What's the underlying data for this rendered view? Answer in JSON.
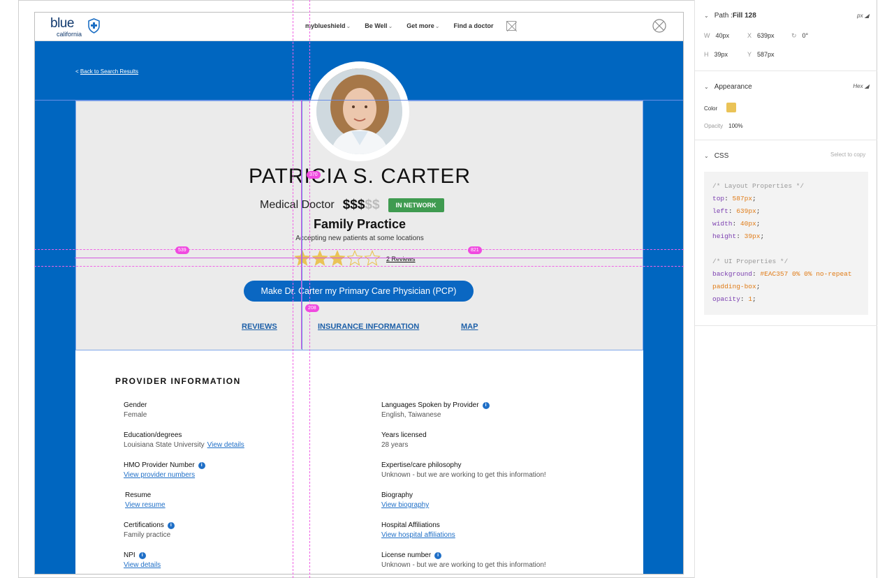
{
  "site": {
    "logo_word": "blue",
    "logo_sub": "california",
    "nav": [
      {
        "label": "myblueshield",
        "has_chevron": true
      },
      {
        "label": "Be Well",
        "has_chevron": true
      },
      {
        "label": "Get more",
        "has_chevron": true
      },
      {
        "label": "Find a doctor",
        "has_chevron": false
      }
    ],
    "back_link": "Back to Search Results",
    "back_prefix": "<"
  },
  "provider": {
    "name": "PATRICIA S. CARTER",
    "role": "Medical Doctor",
    "cost_active": "$$$",
    "cost_inactive": "$$",
    "network_badge": "IN NETWORK",
    "specialty": "Family Practice",
    "accepting": "Accepting new patients at some locations",
    "rating": 3,
    "rating_max": 5,
    "reviews_link": "2 Reviews",
    "pcp_button": "Make Dr. Carter my Primary Care Physician (PCP)",
    "tabs": [
      "REVIEWS",
      "INSURANCE INFORMATION",
      "MAP"
    ]
  },
  "info": {
    "title": "PROVIDER INFORMATION",
    "left": [
      {
        "label": "Gender",
        "value": "Female",
        "link": "",
        "info": false
      },
      {
        "label": "Education/degrees",
        "value": "Louisiana State University",
        "link": "View details",
        "info": false
      },
      {
        "label": "HMO Provider Number",
        "value": "",
        "link": "View provider numbers",
        "info": true
      },
      {
        "label": "Resume",
        "value": "",
        "link": "View resume",
        "info": false
      },
      {
        "label": "Certifications",
        "value": "Family practice",
        "link": "",
        "info": true
      },
      {
        "label": "NPI",
        "value": "",
        "link": "View details",
        "info": true
      }
    ],
    "right": [
      {
        "label": "Languages Spoken by Provider",
        "value": "English, Taiwanese",
        "link": "",
        "info": true
      },
      {
        "label": "Years licensed",
        "value": "28 years",
        "link": "",
        "info": false
      },
      {
        "label": "Expertise/care philosophy",
        "value": "Unknown - but we are working to get this information!",
        "link": "",
        "info": false
      },
      {
        "label": "Biography",
        "value": "",
        "link": "View biography",
        "info": false
      },
      {
        "label": "Hospital Affiliations",
        "value": "",
        "link": "View hospital affiliations",
        "info": false
      },
      {
        "label": "License number",
        "value": "Unknown - but we are working to get this information!",
        "link": "",
        "info": true
      }
    ],
    "info_glyph": "i"
  },
  "guides": {
    "labels": [
      "370",
      "539",
      "821",
      "208"
    ]
  },
  "inspector": {
    "path_label": "Path : ",
    "path_name": "Fill 128",
    "unit_px": "px",
    "w_label": "W",
    "w_value": "40px",
    "x_label": "X",
    "x_value": "639px",
    "rot_value": "0°",
    "h_label": "H",
    "h_value": "39px",
    "y_label": "Y",
    "y_value": "587px",
    "appearance": "Appearance",
    "unit_hex": "Hex",
    "color_label": "Color",
    "swatch_color": "#EAC357",
    "opacity_label": "Opacity",
    "opacity_value": "100%",
    "css_label": "CSS",
    "select_copy": "Select to copy",
    "css_lines": [
      {
        "type": "comment",
        "text": "/* Layout Properties */"
      },
      {
        "type": "prop",
        "prop": "top",
        "val": "587px"
      },
      {
        "type": "prop",
        "prop": "left",
        "val": "639px"
      },
      {
        "type": "prop",
        "prop": "width",
        "val": "40px"
      },
      {
        "type": "prop",
        "prop": "height",
        "val": "39px"
      },
      {
        "type": "blank",
        "text": ""
      },
      {
        "type": "comment",
        "text": "/* UI Properties */"
      },
      {
        "type": "prop",
        "prop": "background",
        "val": "#EAC357 0% 0% no-repeat padding-box"
      },
      {
        "type": "prop",
        "prop": "opacity",
        "val": "1"
      }
    ]
  },
  "colors": {
    "brand_blue": "#0066c0",
    "badge_green": "#3f9b50",
    "star_gold": "#EAC357",
    "guide_magenta": "#f062e6",
    "link_blue": "#1f6fc7"
  }
}
